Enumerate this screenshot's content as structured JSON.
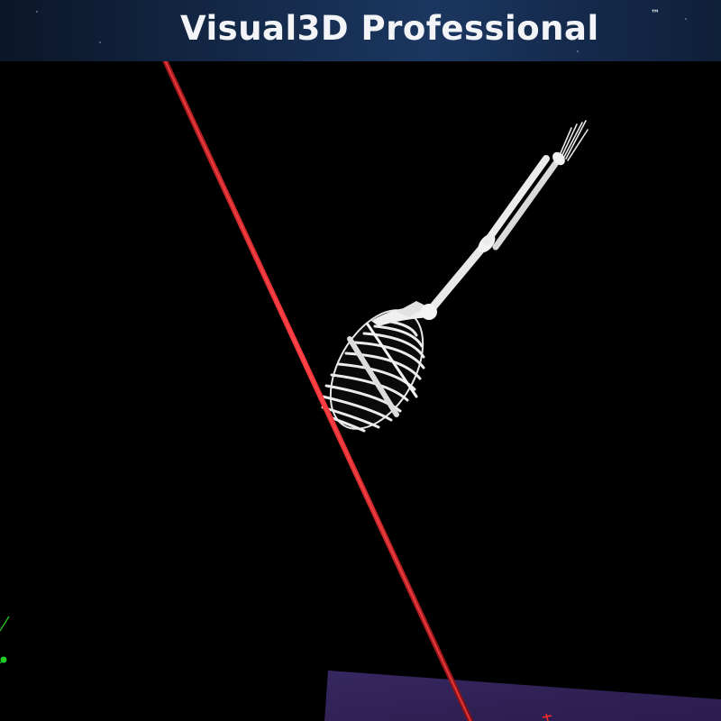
{
  "app": {
    "banner_title": "Visual3D Professional",
    "trademark": "™"
  },
  "scene": {
    "background_color": "#000000",
    "skeleton_color": "#ececec",
    "force_vector_color": "#e0191f",
    "force_plate_color": "#2e2052",
    "global_axis_x_color": "#ff2a2a",
    "global_axis_y_color": "#22cc22",
    "skeleton_parts": [
      "ribcage",
      "humerus",
      "ulna",
      "radius",
      "hand"
    ]
  }
}
